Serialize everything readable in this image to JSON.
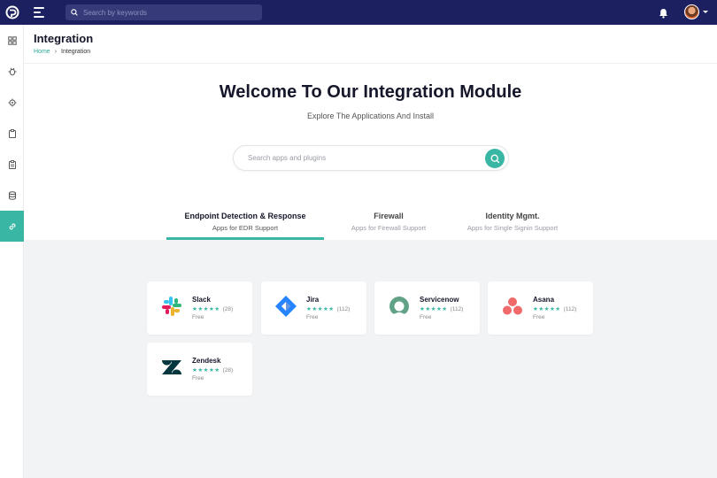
{
  "topbar": {
    "search_placeholder": "Search by keywords"
  },
  "sidebar": {
    "items": [
      {
        "icon": "dashboard-icon",
        "active": false
      },
      {
        "icon": "bug-icon",
        "active": false
      },
      {
        "icon": "settings-bug-icon",
        "active": false
      },
      {
        "icon": "clipboard-icon",
        "active": false
      },
      {
        "icon": "checklist-icon",
        "active": false
      },
      {
        "icon": "database-icon",
        "active": false
      },
      {
        "icon": "link-icon",
        "active": true
      }
    ]
  },
  "header": {
    "title": "Integration",
    "breadcrumb": {
      "home": "Home",
      "current": "Integration"
    }
  },
  "hero": {
    "title": "Welcome To Our Integration Module",
    "subtitle": "Explore The Applications And Install",
    "search_placeholder": "Search apps and plugins"
  },
  "tabs": [
    {
      "label": "Endpoint Detection & Response",
      "sub": "Apps for EDR Support",
      "active": true
    },
    {
      "label": "Firewall",
      "sub": "Apps for Firewall Support",
      "active": false
    },
    {
      "label": "Identity Mgmt.",
      "sub": "Apps for Single Signin Support",
      "active": false
    }
  ],
  "apps": [
    {
      "name": "Slack",
      "stars": "★★★★★",
      "count": "(28)",
      "price": "Free",
      "icon": "slack-logo"
    },
    {
      "name": "Jira",
      "stars": "★★★★★",
      "count": "(112)",
      "price": "Free",
      "icon": "jira-logo"
    },
    {
      "name": "Servicenow",
      "stars": "★★★★★",
      "count": "(112)",
      "price": "Free",
      "icon": "servicenow-logo"
    },
    {
      "name": "Asana",
      "stars": "★★★★★",
      "count": "(112)",
      "price": "Free",
      "icon": "asana-logo"
    },
    {
      "name": "Zendesk",
      "stars": "★★★★★",
      "count": "(28)",
      "price": "Free",
      "icon": "zendesk-logo"
    }
  ],
  "colors": {
    "topbar": "#1d2060",
    "accent": "#3ab7a4",
    "grid_bg": "#f1f3f5"
  }
}
